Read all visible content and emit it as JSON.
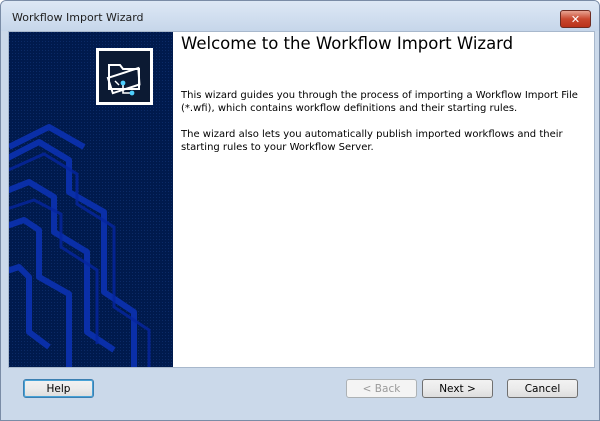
{
  "window": {
    "title": "Workflow Import Wizard",
    "close_icon": "close-icon"
  },
  "banner": {
    "logo_icon": "folder-workflow-icon"
  },
  "main": {
    "heading": "Welcome to the Workflow Import Wizard",
    "paragraph1": "This wizard guides you through the process of importing a Workflow Import File (*.wfi), which contains workflow definitions and their starting rules.",
    "paragraph2": "The wizard also lets you automatically publish imported workflows and their starting rules to your Workflow Server."
  },
  "footer": {
    "help_label": "Help",
    "back_label": "< Back",
    "next_label": "Next >",
    "cancel_label": "Cancel"
  },
  "colors": {
    "banner_bg": "#001a4d",
    "banner_lines": "#0a2fa8",
    "close_button": "#c9482f",
    "window_frame": "#cbd9ea"
  }
}
